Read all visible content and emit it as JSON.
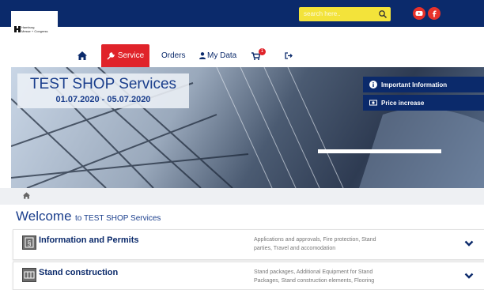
{
  "header": {
    "logo_text": "Hamburg\nMesse + Congress",
    "search_placeholder": "search here..",
    "icons": [
      "search-icon",
      "youtube-icon",
      "facebook-icon"
    ]
  },
  "nav": {
    "items": [
      {
        "id": "home",
        "icon": "home-icon"
      },
      {
        "id": "service",
        "label": "Service",
        "icon": "wrench-icon",
        "active": true
      },
      {
        "id": "orders",
        "label": "Orders"
      },
      {
        "id": "mydata",
        "label": "My Data",
        "icon": "user-icon"
      },
      {
        "id": "cart",
        "icon": "cart-icon",
        "badge": "1"
      },
      {
        "id": "logout",
        "icon": "logout-icon"
      }
    ]
  },
  "hero": {
    "title": "TEST SHOP Services",
    "dates": "01.07.2020 - 05.07.2020",
    "links": [
      {
        "label": "Important Information",
        "icon": "info-icon"
      },
      {
        "label": "Price increase",
        "icon": "money-icon"
      }
    ]
  },
  "breadcrumb": {
    "icon": "home-icon"
  },
  "welcome": {
    "big": "Welcome",
    "small": "to TEST SHOP Services"
  },
  "panels": [
    {
      "title": "Information and Permits",
      "description": "Applications and approvals, Fire protection, Stand parties, Travel and accomodation",
      "icon": "permits-icon"
    },
    {
      "title": "Stand construction",
      "description": "Stand packages, Additional Equipment for Stand Packages, Stand construction elements, Flooring",
      "icon": "stand-icon"
    }
  ],
  "colors": {
    "navy": "#0b2a6b",
    "red": "#e0232a",
    "search_yellow": "#f3e33a",
    "title_blue": "#1a3e8c"
  }
}
